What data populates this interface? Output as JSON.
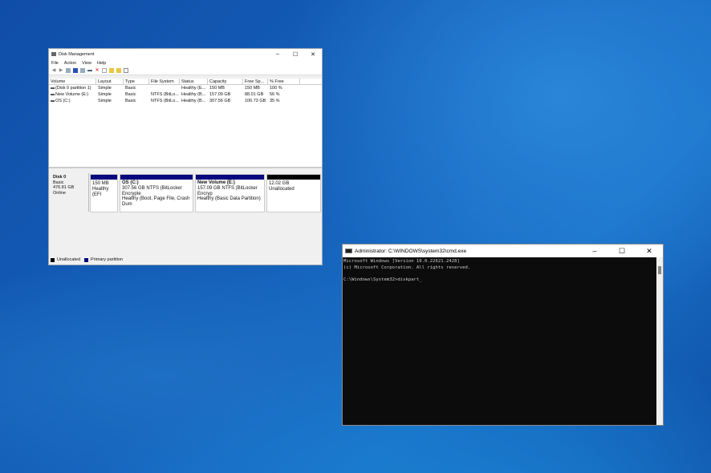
{
  "disk_management": {
    "title": "Disk Management",
    "menu": [
      "File",
      "Action",
      "View",
      "Help"
    ],
    "columns": [
      "Volume",
      "Layout",
      "Type",
      "File System",
      "Status",
      "Capacity",
      "Free Sp...",
      "% Free"
    ],
    "rows": [
      [
        "(Disk 0 partition 1)",
        "Simple",
        "Basic",
        "",
        "Healthy (E...",
        "150 MB",
        "150 MB",
        "100 %"
      ],
      [
        "New Volume (E:)",
        "Simple",
        "Basic",
        "NTFS (BitLo...",
        "Healthy (B...",
        "157.09 GB",
        "88.01 GB",
        "56 %"
      ],
      [
        "OS (C:)",
        "Simple",
        "Basic",
        "NTFS (BitLo...",
        "Healthy (B...",
        "307.56 GB",
        "106.73 GB",
        "35 %"
      ]
    ],
    "disk": {
      "name": "Disk 0",
      "type": "Basic",
      "size": "476.81 GB",
      "status": "Online"
    },
    "partitions": [
      {
        "name": "",
        "line1": "150 MB",
        "line2": "Healthy (EFI"
      },
      {
        "name": "OS  (C:)",
        "line1": "307.56 GB NTFS (BitLocker Encrypte",
        "line2": "Healthy (Boot, Page File, Crash Dum"
      },
      {
        "name": "New Volume  (E:)",
        "line1": "157.09 GB NTFS (BitLocker Encryp",
        "line2": "Healthy (Basic Data Partition)"
      },
      {
        "name": "",
        "line1": "12.02 GB",
        "line2": "Unallocated"
      }
    ],
    "legend": [
      "Unallocated",
      "Primary partition"
    ]
  },
  "cmd": {
    "title": "Administrator: C:\\WINDOWS\\system32\\cmd.exe",
    "lines": [
      "Microsoft Windows [Version 10.0.22621.2428]",
      "(c) Microsoft Corporation. All rights reserved.",
      "",
      "C:\\Windows\\System32>diskpart"
    ]
  }
}
